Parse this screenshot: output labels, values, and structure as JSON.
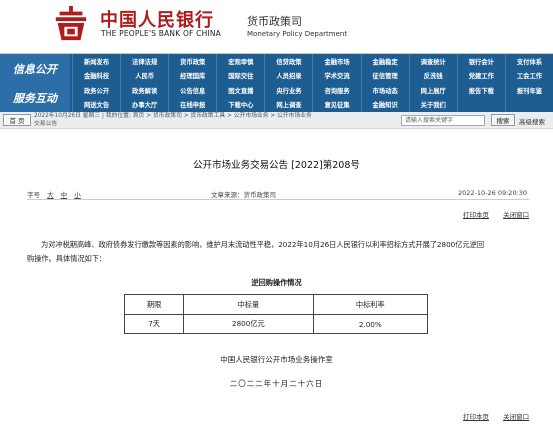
{
  "header": {
    "cn_name": "中国人民银行",
    "en_name": "THE PEOPLE'S BANK OF CHINA",
    "dept_cn": "货币政策司",
    "dept_en": "Monetary Policy Department",
    "brand_color": "#b01b1b"
  },
  "nav": {
    "side": [
      "信息公开",
      "服务互动"
    ],
    "items": [
      "新闻发布",
      "法律法规",
      "货币政策",
      "宏观审慎",
      "信贷政策",
      "金融市场",
      "金融稳定",
      "调查统计",
      "银行会计",
      "支付体系",
      "金融科技",
      "人民币",
      "经理国库",
      "国际交往",
      "人员招录",
      "学术交流",
      "征信管理",
      "反洗钱",
      "党建工作",
      "工会工作",
      "政务公开",
      "政务解读",
      "公告信息",
      "图文直播",
      "央行业务",
      "咨询服务",
      "市场动态",
      "网上展厅",
      "报告下载",
      "报刊年鉴",
      "网送文告",
      "办事大厅",
      "在线申报",
      "下载中心",
      "网上调查",
      "意见征集",
      "金融知识",
      "关于我们",
      "",
      ""
    ],
    "color": "#1e5d92"
  },
  "topbar": {
    "home_label": "首 页",
    "info_line1": "2022年10月26日 星期三 | 我的位置: 首页  >  货币政策司  >  货币政策工具  >  公开市场业务  >  公开市场业务",
    "info_line2": "交易公告",
    "search_placeholder": "请输入搜索关键字",
    "search_label": "搜索",
    "advanced_label": "高级搜索"
  },
  "article": {
    "title": "公开市场业务交易公告 [2022]第208号",
    "fontsize_label": "字号",
    "fontsize_options": [
      "大",
      "中",
      "小"
    ],
    "source": "文章来源：货币政策司",
    "datetime": "2022-10-26 09:20:30",
    "print_label": "打印本页",
    "close_label": "关闭窗口",
    "paragraph_line1": "为对冲税期高峰、政府债券发行缴款等因素的影响，维护月末流动性平稳，2022年10月26日人民银行以利率招标方式开展了2800亿元逆回",
    "paragraph_line2": "购操作。具体情况如下：",
    "table_title": "逆回购操作情况",
    "table": {
      "headers": [
        "期限",
        "中标量",
        "中标利率"
      ],
      "rows": [
        [
          "7天",
          "2800亿元",
          "2.00%"
        ]
      ]
    },
    "signature": "中国人民银行公开市场业务操作室",
    "date": "二〇二二年十月二十六日"
  }
}
